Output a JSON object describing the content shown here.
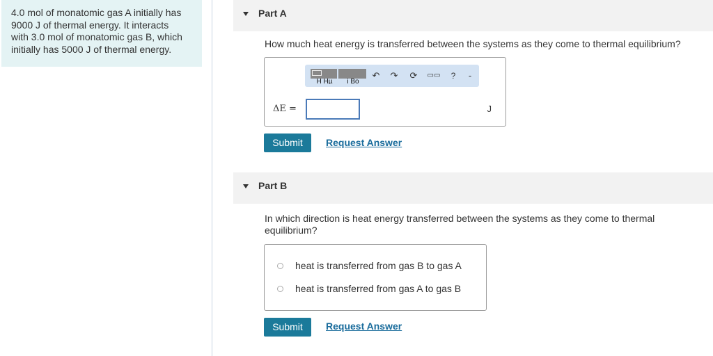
{
  "problem": {
    "lines": [
      "4.0 mol of monatomic gas A initially has",
      "9000 J of thermal energy. It interacts",
      "with 3.0 mol of monatomic gas B, which",
      "initially has 5000 J of thermal energy."
    ]
  },
  "partA": {
    "title": "Part A",
    "question": "How much heat energy is transferred between the systems as they come to thermal equilibrium?",
    "toolbar": {
      "template1_label": "H Hµ",
      "template2_label": "i Bo",
      "undo_icon": "↶",
      "redo_icon": "↷",
      "reset_icon": "⟳",
      "keyboard_icon": "▭▭",
      "help_icon": "?",
      "more_label": "-"
    },
    "equation_label": "ΔE =",
    "input_value": "",
    "unit": "J",
    "submit_label": "Submit",
    "request_label": "Request Answer"
  },
  "partB": {
    "title": "Part B",
    "question_line1": "In which direction is heat energy transferred between the systems as they come to thermal",
    "question_line2": "equilibrium?",
    "choices": [
      {
        "label": "heat is transferred from gas B to gas A",
        "selected": false
      },
      {
        "label": "heat is transferred from gas A to gas B",
        "selected": false
      }
    ],
    "submit_label": "Submit",
    "request_label": "Request Answer"
  },
  "colors": {
    "problem_bg": "#e4f3f4",
    "header_bg": "#f2f2f2",
    "submit_bg": "#1b7a9a",
    "link": "#1a6c9c",
    "toolbar_bg": "#d3e2f3"
  }
}
